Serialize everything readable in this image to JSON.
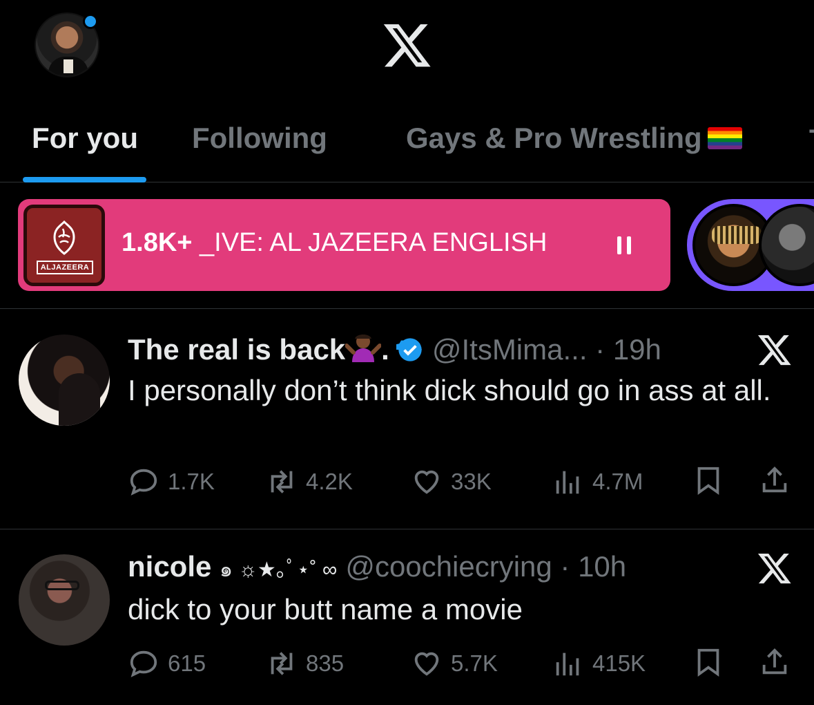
{
  "header": {
    "logo": "x-logo",
    "accent": "#1d9bf0"
  },
  "tabs": [
    {
      "label": "For you",
      "active": true
    },
    {
      "label": "Following",
      "active": false
    },
    {
      "label": "Gays & Pro Wrestling",
      "active": false
    }
  ],
  "spaces": {
    "count": "1.8K+",
    "title": "_IVE: AL JAZEERA ENGLISH",
    "logo_label": "ALJAZEERA",
    "color": "#e23b7b",
    "ring_color": "#7856ff"
  },
  "posts": [
    {
      "name": "The real is back",
      "name_suffix": ".",
      "handle": "@ItsMima...",
      "time": "· 19h",
      "text": "I personally don’t think dick should go in ass at all.",
      "replies": "1.7K",
      "reposts": "4.2K",
      "likes": "33K",
      "views": "4.7M"
    },
    {
      "name": "nicole",
      "name_decor": "๑ ☼★｡ﾟ⋆˚ ∞",
      "handle": "@coochiecrying",
      "time": "· 10h",
      "text": "dick to your butt name a movie",
      "replies": "615",
      "reposts": "835",
      "likes": "5.7K",
      "views": "415K"
    }
  ]
}
